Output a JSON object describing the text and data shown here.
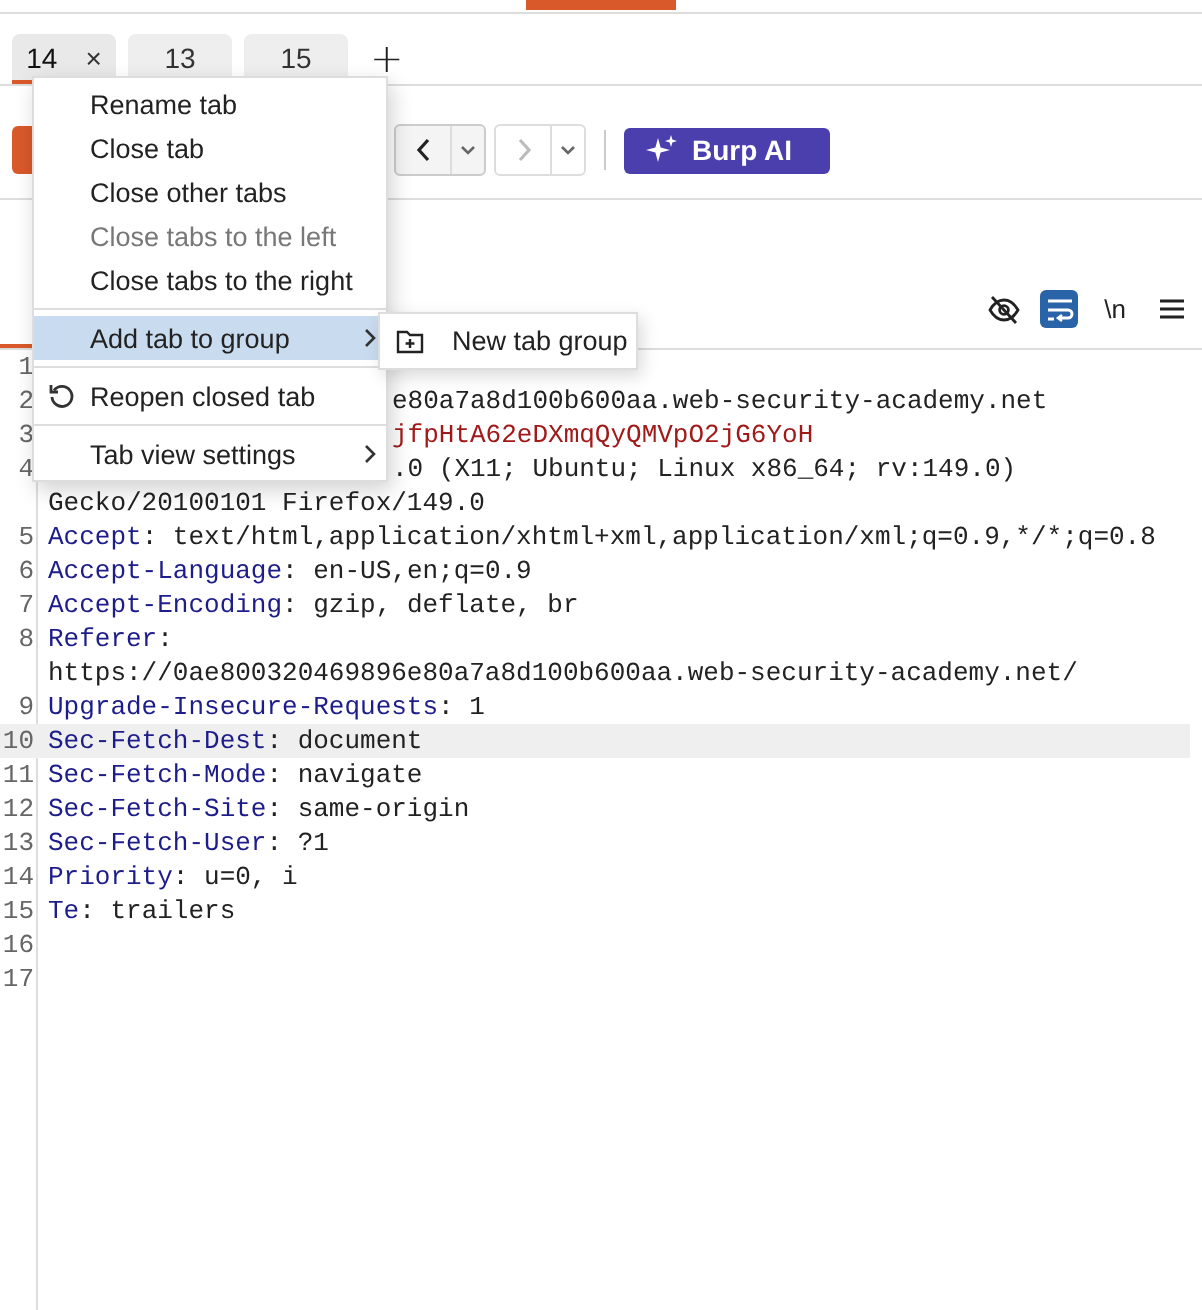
{
  "tabs": [
    {
      "label": "14",
      "selected": true,
      "close": "×"
    },
    {
      "label": "13",
      "selected": false
    },
    {
      "label": "15",
      "selected": false
    }
  ],
  "new_tab": "+",
  "toolbar": {
    "back_disabled": false,
    "forward_disabled": true,
    "ai_button": "Burp AI"
  },
  "view_toggles": [
    {
      "kind": "hide",
      "on": false
    },
    {
      "kind": "wrap",
      "on": true
    },
    {
      "kind": "newline",
      "label": "\\n",
      "on": false
    },
    {
      "kind": "menu",
      "on": false
    }
  ],
  "code_lines": [
    {
      "num": "1",
      "highlighted": false
    },
    {
      "num": "2",
      "cut": true,
      "highlighted": false,
      "parts": [
        {
          "text": "e80a7a8d100b600aa.web-security-academy.net",
          "kind": "value"
        }
      ]
    },
    {
      "num": "3",
      "cut": true,
      "highlighted": false,
      "parts": [
        {
          "text": "jfpHtA62eDXmqQyQMVpO2jG6YoH",
          "kind": "cookie"
        }
      ]
    },
    {
      "num": "4",
      "cut": true,
      "highlighted": false,
      "parts": [
        {
          "text": ".0 (X11; Ubuntu; Linux x86_64; rv:149.0)",
          "kind": "value"
        },
        {
          "text": "Gecko/20100101 Firefox/149.0",
          "kind": "value",
          "wrapped": true
        }
      ]
    },
    {
      "num": "5",
      "cut": false,
      "highlighted": false,
      "parts": [
        {
          "text": "Accept",
          "kind": "key"
        },
        {
          "text": ": text/html,application/xhtml+xml,application/xml;q=0.9,*/*;q=0.8",
          "kind": "value"
        }
      ]
    },
    {
      "num": "6",
      "cut": false,
      "highlighted": false,
      "parts": [
        {
          "text": "Accept-Language",
          "kind": "key"
        },
        {
          "text": ": en-US,en;q=0.9",
          "kind": "value"
        }
      ]
    },
    {
      "num": "7",
      "cut": false,
      "highlighted": false,
      "parts": [
        {
          "text": "Accept-Encoding",
          "kind": "key"
        },
        {
          "text": ": gzip, deflate, br",
          "kind": "value"
        }
      ]
    },
    {
      "num": "8",
      "cut": false,
      "highlighted": false,
      "parts": [
        {
          "text": "Referer",
          "kind": "key"
        },
        {
          "text": ":",
          "kind": "value"
        },
        {
          "text": "https://0ae800320469896e80a7a8d100b600aa.web-security-academy.net/",
          "kind": "value",
          "wrapped": true
        }
      ]
    },
    {
      "num": "9",
      "cut": false,
      "highlighted": false,
      "parts": [
        {
          "text": "Upgrade-Insecure-Requests",
          "kind": "key"
        },
        {
          "text": ": 1",
          "kind": "value"
        }
      ]
    },
    {
      "num": "10",
      "cut": false,
      "highlighted": true,
      "parts": [
        {
          "text": "Sec-Fetch-Dest",
          "kind": "key"
        },
        {
          "text": ": document",
          "kind": "value"
        }
      ]
    },
    {
      "num": "11",
      "cut": false,
      "highlighted": false,
      "parts": [
        {
          "text": "Sec-Fetch-Mode",
          "kind": "key"
        },
        {
          "text": ": navigate",
          "kind": "value"
        }
      ]
    },
    {
      "num": "12",
      "cut": false,
      "highlighted": false,
      "parts": [
        {
          "text": "Sec-Fetch-Site",
          "kind": "key"
        },
        {
          "text": ": same-origin",
          "kind": "value"
        }
      ]
    },
    {
      "num": "13",
      "cut": false,
      "highlighted": false,
      "parts": [
        {
          "text": "Sec-Fetch-User",
          "kind": "key"
        },
        {
          "text": ": ?1",
          "kind": "value"
        }
      ]
    },
    {
      "num": "14",
      "cut": false,
      "highlighted": false,
      "parts": [
        {
          "text": "Priority",
          "kind": "key"
        },
        {
          "text": ": u=0, i",
          "kind": "value"
        }
      ]
    },
    {
      "num": "15",
      "cut": false,
      "highlighted": false,
      "parts": [
        {
          "text": "Te",
          "kind": "key"
        },
        {
          "text": ": trailers",
          "kind": "value"
        }
      ]
    },
    {
      "num": "16",
      "highlighted": false
    },
    {
      "num": "17",
      "highlighted": false
    }
  ],
  "context_menu": {
    "items": [
      {
        "kind": "item",
        "label": "Rename tab",
        "disabled": false,
        "selected": false
      },
      {
        "kind": "item",
        "label": "Close tab",
        "disabled": false,
        "selected": false
      },
      {
        "kind": "item",
        "label": "Close other tabs",
        "disabled": false,
        "selected": false
      },
      {
        "kind": "item",
        "label": "Close tabs to the left",
        "disabled": true,
        "selected": false
      },
      {
        "kind": "item",
        "label": "Close tabs to the right",
        "disabled": false,
        "selected": false
      },
      {
        "kind": "separator"
      },
      {
        "kind": "submenu",
        "label": "Add tab to group",
        "disabled": false,
        "selected": true
      },
      {
        "kind": "separator"
      },
      {
        "kind": "reopen",
        "label": "Reopen closed tab",
        "disabled": false,
        "selected": false
      },
      {
        "kind": "separator"
      },
      {
        "kind": "submenu",
        "label": "Tab view settings",
        "disabled": false,
        "selected": false
      }
    ],
    "submenu": {
      "label": "New tab group"
    }
  }
}
